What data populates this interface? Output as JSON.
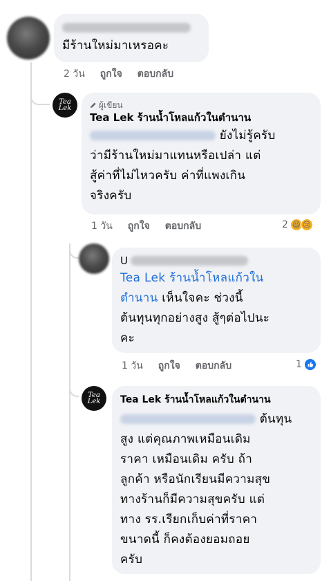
{
  "comment1": {
    "text": "มีร้านใหม่มาเหรอคะ",
    "time": "2 วัน",
    "like": "ถูกใจ",
    "reply": "ตอบกลับ"
  },
  "reply1": {
    "badge": "ผู้เขียน",
    "author": "Tea Lek ร้านน้ำโหลแก้วในตำนาน",
    "line1_suffix": "ยังไม่รู้ครับ",
    "line2": "ว่ามีร้านใหม่มาแทนหรือเปล่า แต่",
    "line3": "สู้ค่าที่ไม่ไหวครับ ค่าที่แพงเกิน",
    "line4": "จริงครับ",
    "time": "1 วัน",
    "like": "ถูกใจ",
    "reply": "ตอบกลับ",
    "reaction_count": "2",
    "reactions": [
      "haha",
      "sad"
    ]
  },
  "reply2": {
    "author_initial": "U",
    "mention1": "Tea Lek ร้านน้ำโหลแก้วใน",
    "mention2": "ตำนาน",
    "line2_suffix": "เห็นใจคะ ช่วงนี้",
    "line3": "ต้นทุนทุกอย่างสูง สู้ๆต่อไปนะ",
    "line4": "คะ",
    "time": "1 วัน",
    "like": "ถูกใจ",
    "reply": "ตอบกลับ",
    "reaction_count": "1",
    "reactions": [
      "like"
    ]
  },
  "reply3": {
    "author": "Tea Lek ร้านน้ำโหลแก้วในตำนาน",
    "line1_suffix": "ต้นทุน",
    "line2": "สูง แต่คุณภาพเหมือนเดิม",
    "line3": "ราคา เหมือนเดิม ครับ ถ้า",
    "line4": "ลูกค้า หรือนักเรียนมีความสุข",
    "line5": "ทางร้านก็มีความสุขครับ แต่",
    "line6": "ทาง รร.เรียกเก็บค่าที่ราคา",
    "line7": "ขนาดนี้ ก็คงต้องยอมถอย",
    "line8": "ครับ"
  },
  "brand_logo_text": "Tea Lek",
  "colors": {
    "bubble": "#f0f2f5",
    "mention": "#216fdb",
    "meta": "#65676b",
    "thread": "#d9dadd"
  }
}
